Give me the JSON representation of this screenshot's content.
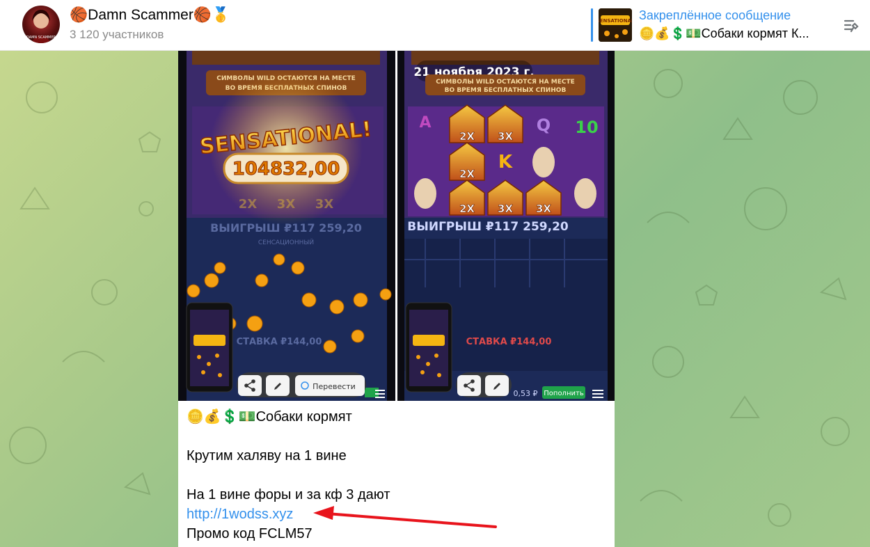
{
  "header": {
    "title": "🏀Damn Scammer🏀🥇",
    "subtitle": "3 120 участников",
    "pinned_title": "Закреплённое сообщение",
    "pinned_text": "🪙💰💲💵Собаки кормят К..."
  },
  "media": {
    "left": {
      "banner": "СИМВОЛЫ WILD ОСТАЮТСЯ НА МЕСТЕ ВО ВРЕМЯ БЕСПЛАТНЫХ СПИНОВ",
      "sensational": "SENSATIONAL!",
      "big_win": "104832,00",
      "multipliers": [
        "2X",
        "3X",
        "3X"
      ],
      "win_label": "ВЫИГРЫШ ₽117 259,20",
      "win_caption": "СЕНСАЦИОННЫЙ",
      "stake_label": "СТАВКА ₽144,00",
      "translate_label": "Перевести"
    },
    "right": {
      "date_badge": "21 ноября 2023 г.",
      "banner": "СИМВОЛЫ WILD ОСТАЮТСЯ НА МЕСТЕ ВО ВРЕМЯ БЕСПЛАТНЫХ СПИНОВ",
      "reel_letters": [
        "A",
        "Q",
        "10",
        "K"
      ],
      "multipliers": [
        "2X",
        "3X",
        "2X",
        "2X",
        "3X",
        "3X"
      ],
      "win_label": "ВЫИГРЫШ ₽117 259,20",
      "stake_label": "СТАВКА ₽144,00",
      "balance": "0,53 ₽",
      "deposit_label": "Пополнить"
    }
  },
  "message": {
    "line1": "🪙💰💲💵Собаки кормят",
    "line2": "Крутим халяву на 1 вине",
    "line3": "На 1 вине форы и за кф 3 дают",
    "link": "http://1wodss.xyz",
    "line5": "Промо код FCLM57"
  },
  "colors": {
    "accent": "#3390ec",
    "annotation_arrow": "#e8141c",
    "gold": "#f5b512",
    "deposit_green": "#1fa34a"
  },
  "icons": [
    "unpin-icon",
    "share-icon",
    "pencil-icon",
    "translate-icon",
    "menu-icon"
  ]
}
